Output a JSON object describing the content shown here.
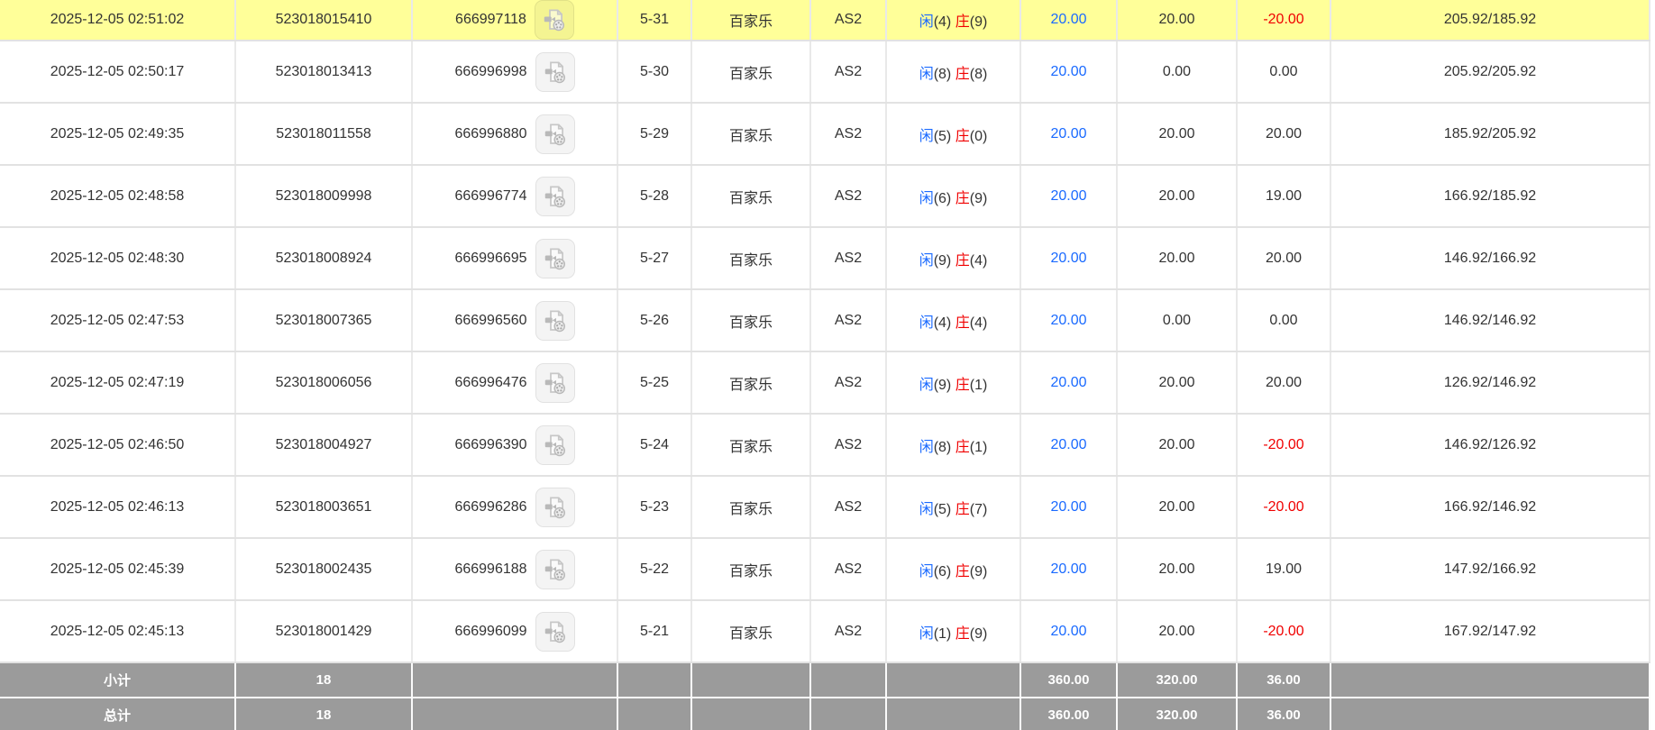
{
  "colors": {
    "highlight_row": "#FFFF99",
    "player_blue": "#1A6AFF",
    "banker_red": "#F00000",
    "bet_amount_blue": "#1A6AFF",
    "loss_red": "#F00000",
    "summary_row_gray": "#9B9B9B"
  },
  "icons": {
    "replay": "video-replay-icon"
  },
  "table": {
    "result_labels": {
      "player": "闲",
      "banker": "庄"
    },
    "rows": [
      {
        "time": "2025-12-05 02:51:02",
        "bet_id": "523018015410",
        "round_id": "666997118",
        "round_no": "5-31",
        "game": "百家乐",
        "table": "AS2",
        "player_score": "4",
        "banker_score": "9",
        "bet": "20.00",
        "valid_bet": "20.00",
        "win_loss": "-20.00",
        "balance": "205.92/185.92",
        "highlight": true
      },
      {
        "time": "2025-12-05 02:50:17",
        "bet_id": "523018013413",
        "round_id": "666996998",
        "round_no": "5-30",
        "game": "百家乐",
        "table": "AS2",
        "player_score": "8",
        "banker_score": "8",
        "bet": "20.00",
        "valid_bet": "0.00",
        "win_loss": "0.00",
        "balance": "205.92/205.92",
        "highlight": false
      },
      {
        "time": "2025-12-05 02:49:35",
        "bet_id": "523018011558",
        "round_id": "666996880",
        "round_no": "5-29",
        "game": "百家乐",
        "table": "AS2",
        "player_score": "5",
        "banker_score": "0",
        "bet": "20.00",
        "valid_bet": "20.00",
        "win_loss": "20.00",
        "balance": "185.92/205.92",
        "highlight": false
      },
      {
        "time": "2025-12-05 02:48:58",
        "bet_id": "523018009998",
        "round_id": "666996774",
        "round_no": "5-28",
        "game": "百家乐",
        "table": "AS2",
        "player_score": "6",
        "banker_score": "9",
        "bet": "20.00",
        "valid_bet": "20.00",
        "win_loss": "19.00",
        "balance": "166.92/185.92",
        "highlight": false
      },
      {
        "time": "2025-12-05 02:48:30",
        "bet_id": "523018008924",
        "round_id": "666996695",
        "round_no": "5-27",
        "game": "百家乐",
        "table": "AS2",
        "player_score": "9",
        "banker_score": "4",
        "bet": "20.00",
        "valid_bet": "20.00",
        "win_loss": "20.00",
        "balance": "146.92/166.92",
        "highlight": false
      },
      {
        "time": "2025-12-05 02:47:53",
        "bet_id": "523018007365",
        "round_id": "666996560",
        "round_no": "5-26",
        "game": "百家乐",
        "table": "AS2",
        "player_score": "4",
        "banker_score": "4",
        "bet": "20.00",
        "valid_bet": "0.00",
        "win_loss": "0.00",
        "balance": "146.92/146.92",
        "highlight": false
      },
      {
        "time": "2025-12-05 02:47:19",
        "bet_id": "523018006056",
        "round_id": "666996476",
        "round_no": "5-25",
        "game": "百家乐",
        "table": "AS2",
        "player_score": "9",
        "banker_score": "1",
        "bet": "20.00",
        "valid_bet": "20.00",
        "win_loss": "20.00",
        "balance": "126.92/146.92",
        "highlight": false
      },
      {
        "time": "2025-12-05 02:46:50",
        "bet_id": "523018004927",
        "round_id": "666996390",
        "round_no": "5-24",
        "game": "百家乐",
        "table": "AS2",
        "player_score": "8",
        "banker_score": "1",
        "bet": "20.00",
        "valid_bet": "20.00",
        "win_loss": "-20.00",
        "balance": "146.92/126.92",
        "highlight": false
      },
      {
        "time": "2025-12-05 02:46:13",
        "bet_id": "523018003651",
        "round_id": "666996286",
        "round_no": "5-23",
        "game": "百家乐",
        "table": "AS2",
        "player_score": "5",
        "banker_score": "7",
        "bet": "20.00",
        "valid_bet": "20.00",
        "win_loss": "-20.00",
        "balance": "166.92/146.92",
        "highlight": false
      },
      {
        "time": "2025-12-05 02:45:39",
        "bet_id": "523018002435",
        "round_id": "666996188",
        "round_no": "5-22",
        "game": "百家乐",
        "table": "AS2",
        "player_score": "6",
        "banker_score": "9",
        "bet": "20.00",
        "valid_bet": "20.00",
        "win_loss": "19.00",
        "balance": "147.92/166.92",
        "highlight": false
      },
      {
        "time": "2025-12-05 02:45:13",
        "bet_id": "523018001429",
        "round_id": "666996099",
        "round_no": "5-21",
        "game": "百家乐",
        "table": "AS2",
        "player_score": "1",
        "banker_score": "9",
        "bet": "20.00",
        "valid_bet": "20.00",
        "win_loss": "-20.00",
        "balance": "167.92/147.92",
        "highlight": false
      }
    ],
    "summary": [
      {
        "label": "小计",
        "count": "18",
        "bet_total": "360.00",
        "valid_total": "320.00",
        "win_total": "36.00"
      },
      {
        "label": "总计",
        "count": "18",
        "bet_total": "360.00",
        "valid_total": "320.00",
        "win_total": "36.00"
      }
    ]
  }
}
